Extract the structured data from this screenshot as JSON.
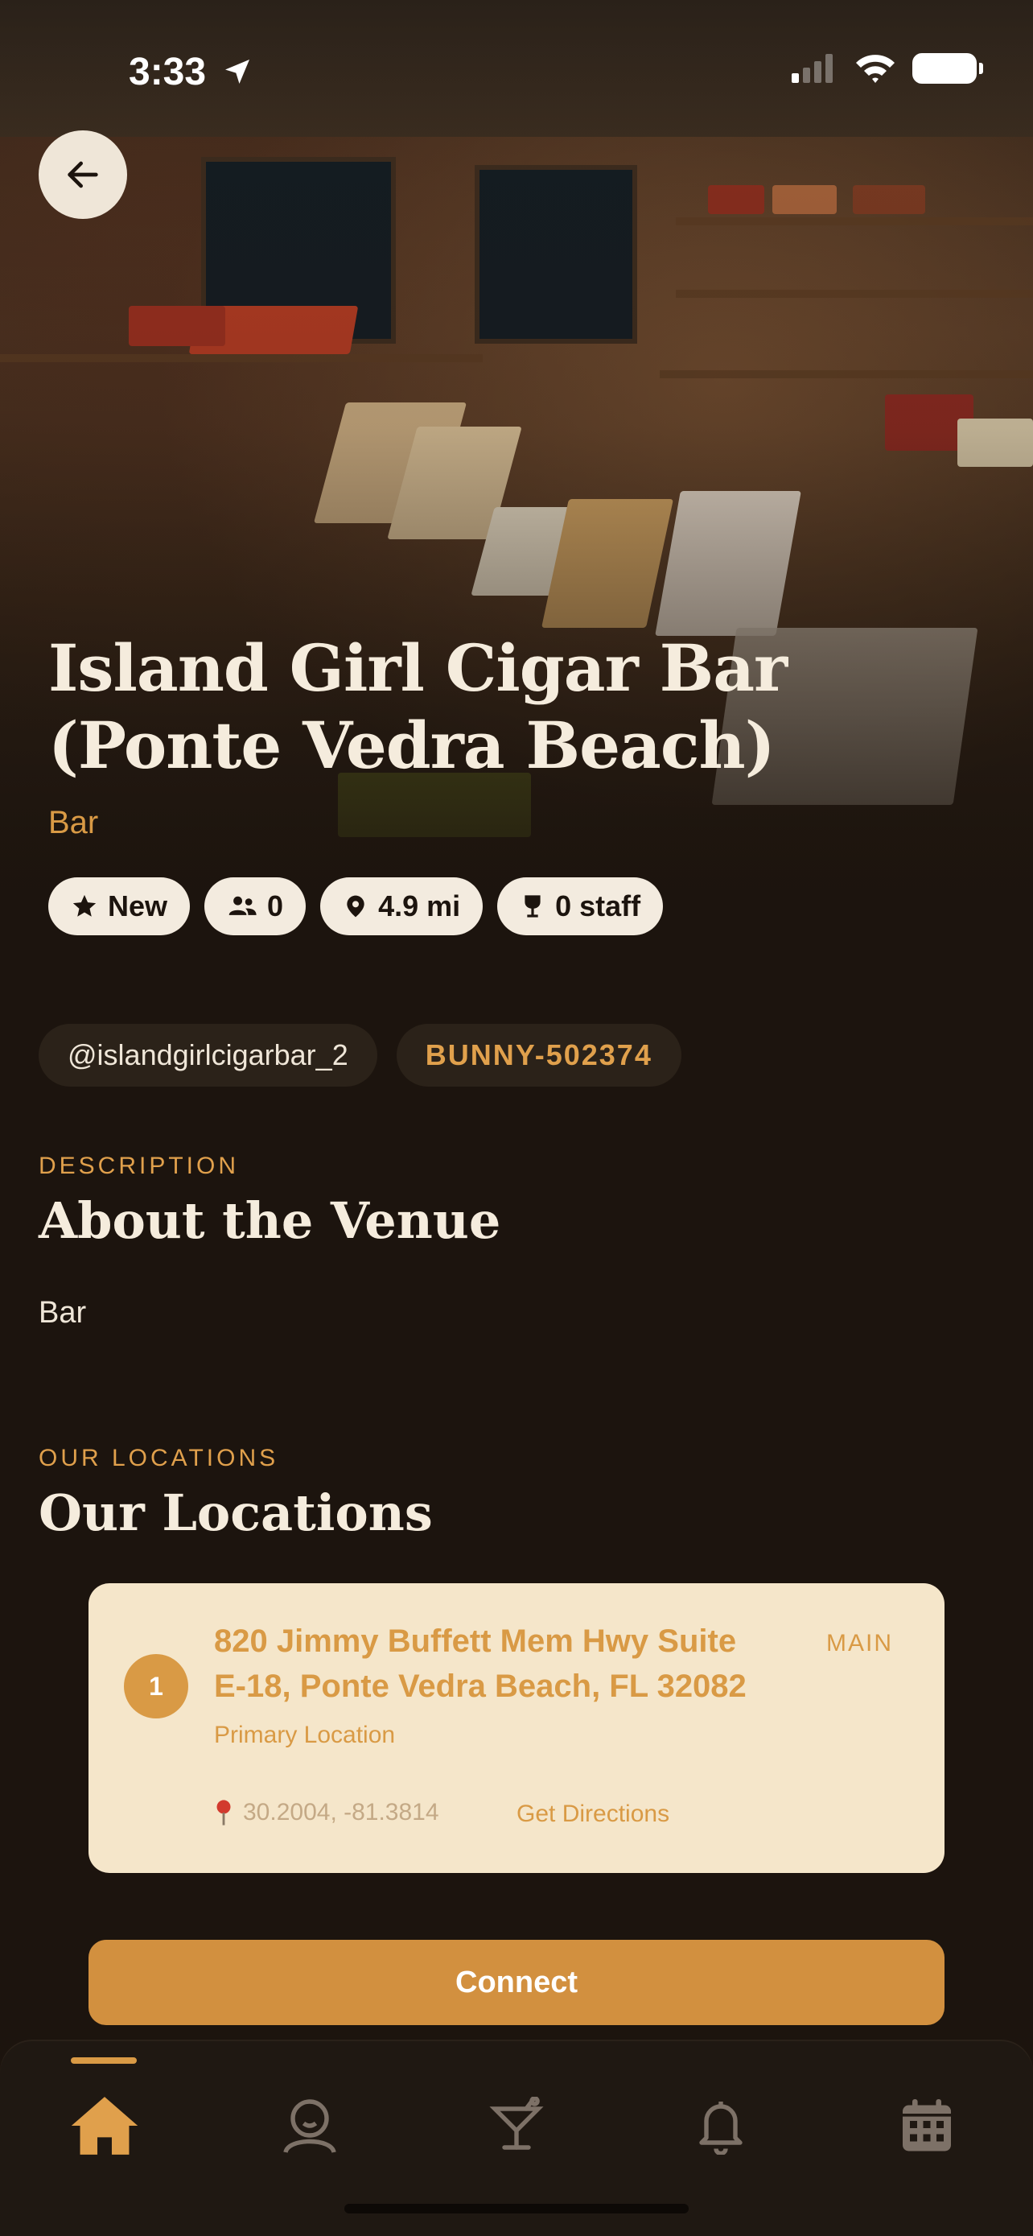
{
  "status_bar": {
    "time": "3:33"
  },
  "venue": {
    "name": "Island Girl Cigar Bar (Ponte Vedra Beach)",
    "type": "Bar",
    "chips": {
      "new": "New",
      "members": "0",
      "distance": "4.9 mi",
      "staff": "0 staff"
    },
    "handle": "@islandgirlcigarbar_2",
    "code": "BUNNY-502374"
  },
  "description": {
    "eyebrow": "DESCRIPTION",
    "title": "About the Venue",
    "text": "Bar"
  },
  "locations": {
    "eyebrow": "OUR LOCATIONS",
    "title": "Our Locations",
    "items": [
      {
        "number": "1",
        "address": "820 Jimmy Buffett Mem Hwy Suite E-18, Ponte Vedra Beach, FL 32082",
        "tag": "MAIN",
        "subtitle": "Primary Location",
        "coords": "30.2004, -81.3814",
        "directions": "Get Directions"
      }
    ]
  },
  "actions": {
    "connect": "Connect"
  },
  "tabbar": {
    "items": [
      "home-icon",
      "profile-icon",
      "cocktail-icon",
      "bell-icon",
      "calendar-icon"
    ],
    "active": "home-icon"
  },
  "colors": {
    "accent": "#d99a45",
    "background": "#1c140e",
    "card": "#f5e6ca"
  }
}
